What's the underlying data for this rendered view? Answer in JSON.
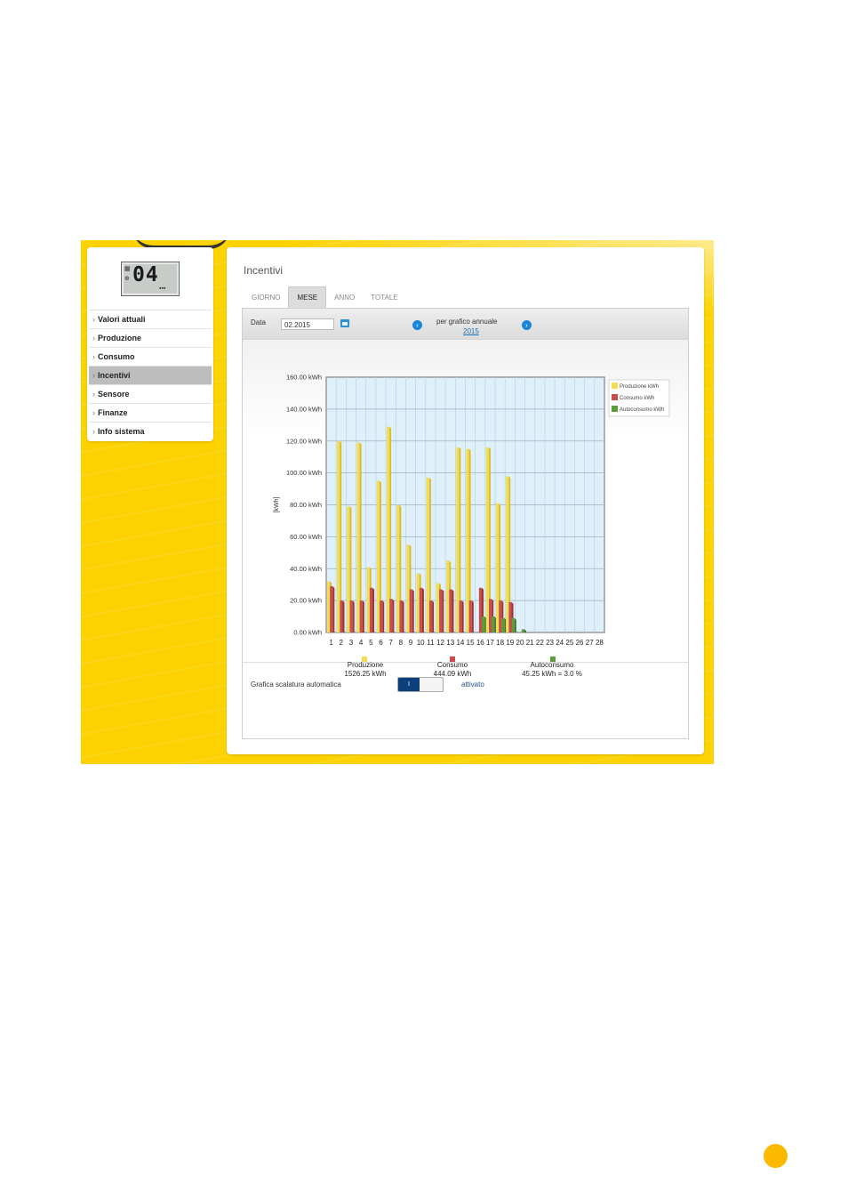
{
  "sidebar": {
    "lcd_digits": "04",
    "items": [
      {
        "label": "Valori attuali",
        "active": false
      },
      {
        "label": "Produzione",
        "active": false
      },
      {
        "label": "Consumo",
        "active": false
      },
      {
        "label": "Incentivi",
        "active": true
      },
      {
        "label": "Sensore",
        "active": false
      },
      {
        "label": "Finanze",
        "active": false
      },
      {
        "label": "Info sistema",
        "active": false
      }
    ]
  },
  "main": {
    "title": "Incentivi",
    "tabs": [
      {
        "label": "GIORNO",
        "active": false
      },
      {
        "label": "MESE",
        "active": true
      },
      {
        "label": "ANNO",
        "active": false
      },
      {
        "label": "TOTALE",
        "active": false
      }
    ],
    "date_label": "Data",
    "date_value": "02.2015",
    "annual_label": "per grafico annuale",
    "annual_year": "2015",
    "auto_scale_label": "Grafica scalatura automatica",
    "toggle_on_label": "I",
    "toggle_state": "attivato"
  },
  "colors": {
    "produzione": "#f3dd54",
    "consumo": "#c94d4a",
    "autoconsumo": "#5c9c3a",
    "plot_bg": "#dff0fb"
  },
  "chart_data": {
    "type": "bar",
    "title": "",
    "xlabel": "",
    "ylabel": "[kWh]",
    "ylim": [
      0,
      160
    ],
    "y_ticks": [
      "0.00 kWh",
      "20.00 kWh",
      "40.00 kWh",
      "60.00 kWh",
      "80.00 kWh",
      "100.00 kWh",
      "120.00 kWh",
      "140.00 kWh",
      "160.00 kWh"
    ],
    "categories": [
      "1",
      "2",
      "3",
      "4",
      "5",
      "6",
      "7",
      "8",
      "9",
      "10",
      "11",
      "12",
      "13",
      "14",
      "15",
      "16",
      "17",
      "18",
      "19",
      "20",
      "21",
      "22",
      "23",
      "24",
      "25",
      "26",
      "27",
      "28"
    ],
    "series": [
      {
        "name": "Produzione kWh",
        "values": [
          32,
          120,
          79,
          119,
          41,
          95,
          129,
          80,
          55,
          37,
          97,
          31,
          45,
          116,
          115,
          0,
          116,
          81,
          98,
          0,
          0,
          0,
          0,
          0,
          0,
          0,
          0,
          0
        ]
      },
      {
        "name": "Consumo kWh",
        "values": [
          29,
          20,
          20,
          20,
          28,
          20,
          21,
          20,
          27,
          28,
          20,
          27,
          27,
          20,
          20,
          28,
          21,
          20,
          19,
          0,
          0,
          0,
          0,
          0,
          0,
          0,
          0,
          0
        ]
      },
      {
        "name": "Autoconsumo kWh",
        "values": [
          0,
          0,
          0,
          0,
          0,
          0,
          0,
          0,
          0,
          0,
          0,
          0,
          0,
          0,
          0,
          10,
          10,
          9,
          9,
          2,
          0,
          0,
          0,
          0,
          0,
          0,
          0,
          0
        ]
      }
    ],
    "legend_position": "top-right",
    "grid": true,
    "totals": [
      {
        "name": "Produzione",
        "value": "1526.25 kWh"
      },
      {
        "name": "Consumo",
        "value": "444.09 kWh"
      },
      {
        "name": "Autoconsumo",
        "value": "45.25 kWh = 3.0 %"
      }
    ]
  }
}
